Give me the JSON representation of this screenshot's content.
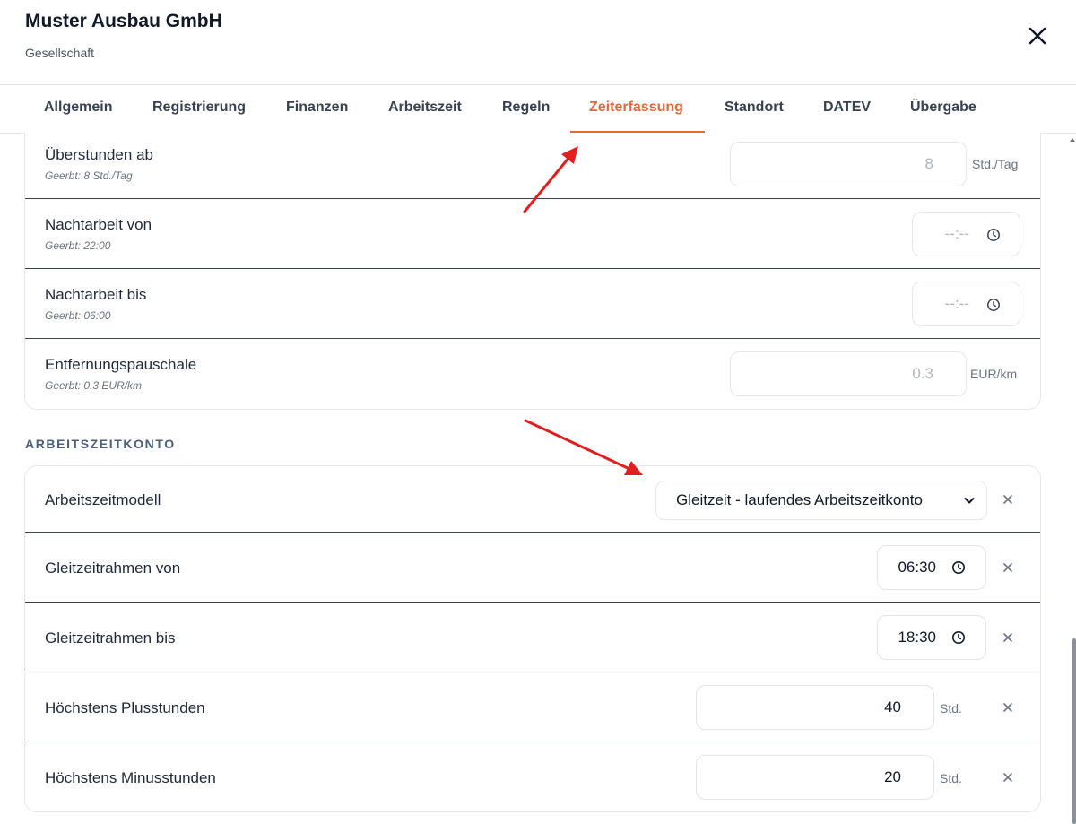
{
  "header": {
    "title": "Muster Ausbau GmbH",
    "subtitle": "Gesellschaft",
    "close_icon": "close-icon"
  },
  "tabs": [
    {
      "label": "Allgemein",
      "active": false
    },
    {
      "label": "Registrierung",
      "active": false
    },
    {
      "label": "Finanzen",
      "active": false
    },
    {
      "label": "Arbeitszeit",
      "active": false
    },
    {
      "label": "Regeln",
      "active": false
    },
    {
      "label": "Zeiterfassung",
      "active": true
    },
    {
      "label": "Standort",
      "active": false
    },
    {
      "label": "DATEV",
      "active": false
    },
    {
      "label": "Übergabe",
      "active": false
    }
  ],
  "inherited_settings": [
    {
      "label": "Überstunden ab",
      "inherited": "Geerbt: 8 Std./Tag",
      "placeholder": "8",
      "unit": "Std./Tag"
    },
    {
      "label": "Nachtarbeit von",
      "inherited": "Geerbt: 22:00",
      "placeholder": "--:--",
      "icon": "clock-icon"
    },
    {
      "label": "Nachtarbeit bis",
      "inherited": "Geerbt: 06:00",
      "placeholder": "--:--",
      "icon": "clock-icon"
    },
    {
      "label": "Entfernungspauschale",
      "inherited": "Geerbt: 0.3 EUR/km",
      "placeholder": "0.3",
      "unit": "EUR/km"
    }
  ],
  "section": {
    "title": "ARBEITSZEITKONTO"
  },
  "account": [
    {
      "label": "Arbeitszeitmodell",
      "value": "Gleitzeit - laufendes Arbeitszeitkonto",
      "type": "select"
    },
    {
      "label": "Gleitzeitrahmen von",
      "value": "06:30",
      "type": "time"
    },
    {
      "label": "Gleitzeitrahmen bis",
      "value": "18:30",
      "type": "time"
    },
    {
      "label": "Höchstens Plusstunden",
      "value": "40",
      "unit": "Std.",
      "type": "number"
    },
    {
      "label": "Höchstens Minusstunden",
      "value": "20",
      "unit": "Std.",
      "type": "number"
    }
  ],
  "colors": {
    "accent": "#e06a3c",
    "annotation_arrow": "#e02020",
    "section_title": "#4b6078"
  }
}
